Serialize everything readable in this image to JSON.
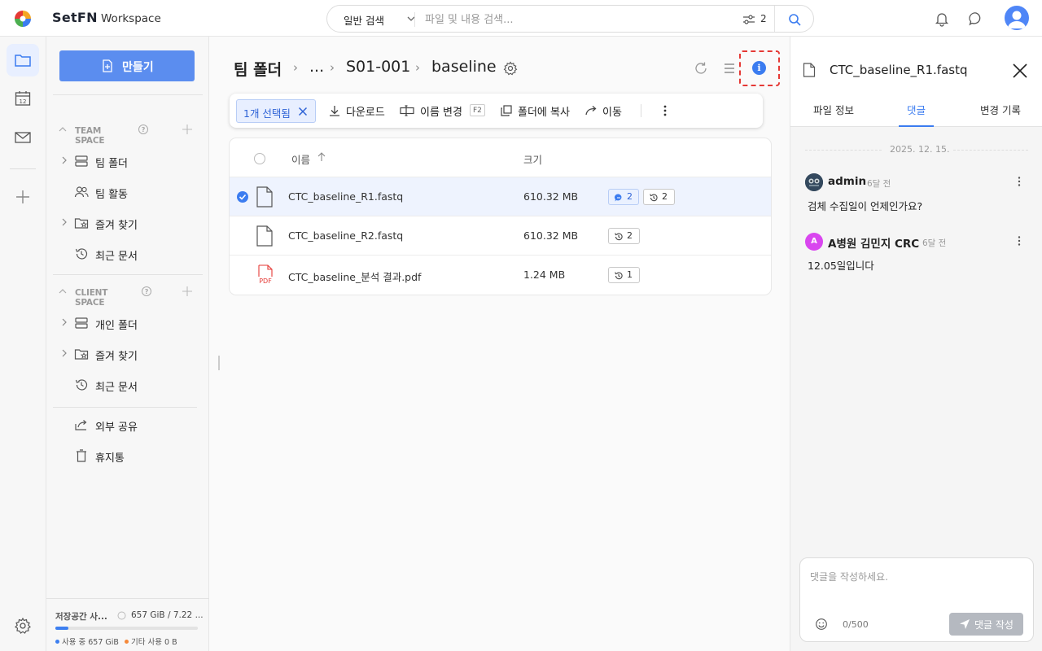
{
  "app": {
    "brand": "SetFN",
    "subtitle": "Workspace"
  },
  "search": {
    "mode": "일반 검색",
    "placeholder": "파일 및 내용 검색...",
    "filter_count": "2"
  },
  "sidebar": {
    "create_label": "만들기",
    "team_space": {
      "header": "TEAM SPACE",
      "items": [
        {
          "label": "팀 폴더",
          "icon": "folder-stack-icon"
        },
        {
          "label": "팀 활동",
          "icon": "people-icon"
        },
        {
          "label": "즐겨 찾기",
          "icon": "star-folder-icon"
        },
        {
          "label": "최근 문서",
          "icon": "history-icon"
        }
      ]
    },
    "client_space": {
      "header": "CLIENT SPACE",
      "items": [
        {
          "label": "개인 폴더",
          "icon": "folder-stack-icon"
        },
        {
          "label": "즐겨 찾기",
          "icon": "star-folder-icon"
        },
        {
          "label": "최근 문서",
          "icon": "history-icon"
        }
      ]
    },
    "extra": [
      {
        "label": "외부 공유",
        "icon": "share-icon"
      },
      {
        "label": "휴지통",
        "icon": "trash-icon"
      }
    ],
    "storage": {
      "label": "저장공간 사...",
      "value": "657 GiB / 7.22 ...",
      "used_fraction": 0.09,
      "used_label": "사용 중 657 GiB",
      "other_label": "기타 사용 0 B",
      "used_color": "#3d7ff0",
      "other_color": "#f5893a"
    }
  },
  "breadcrumb": {
    "root": "팀 폴더",
    "ellipsis": "...",
    "folder": "S01-001",
    "current": "baseline"
  },
  "actionbar": {
    "selected": "1개 선택됨",
    "download": "다운로드",
    "rename": "이름 변경",
    "rename_key": "F2",
    "copy": "폴더에 복사",
    "move": "이동"
  },
  "table": {
    "headers": {
      "name": "이름",
      "size": "크기"
    },
    "rows": [
      {
        "name": "CTC_baseline_R1.fastq",
        "size": "610.32 MB",
        "comments": "2",
        "versions": "2",
        "selected": true,
        "type": "file"
      },
      {
        "name": "CTC_baseline_R2.fastq",
        "size": "610.32 MB",
        "versions": "2",
        "selected": false,
        "type": "file"
      },
      {
        "name": "CTC_baseline_분석 결과.pdf",
        "size": "1.24 MB",
        "versions": "1",
        "selected": false,
        "type": "pdf",
        "type_label": "PDF"
      }
    ]
  },
  "panel": {
    "file_name": "CTC_baseline_R1.fastq",
    "tabs": [
      "파일 정보",
      "댓글",
      "변경 기록"
    ],
    "active_tab": "댓글",
    "date": "2025. 12. 15.",
    "comments": [
      {
        "author": "admin",
        "time": "6달 전",
        "text": "검체 수집일이 언제인가요?"
      },
      {
        "author": "A병원 김민지 CRC",
        "avatar_letter": "A",
        "time": "6달 전",
        "text": "12.05일입니다"
      }
    ],
    "composer": {
      "placeholder": "댓글을 작성하세요.",
      "count": "0/500",
      "submit": "댓글 작성"
    }
  }
}
